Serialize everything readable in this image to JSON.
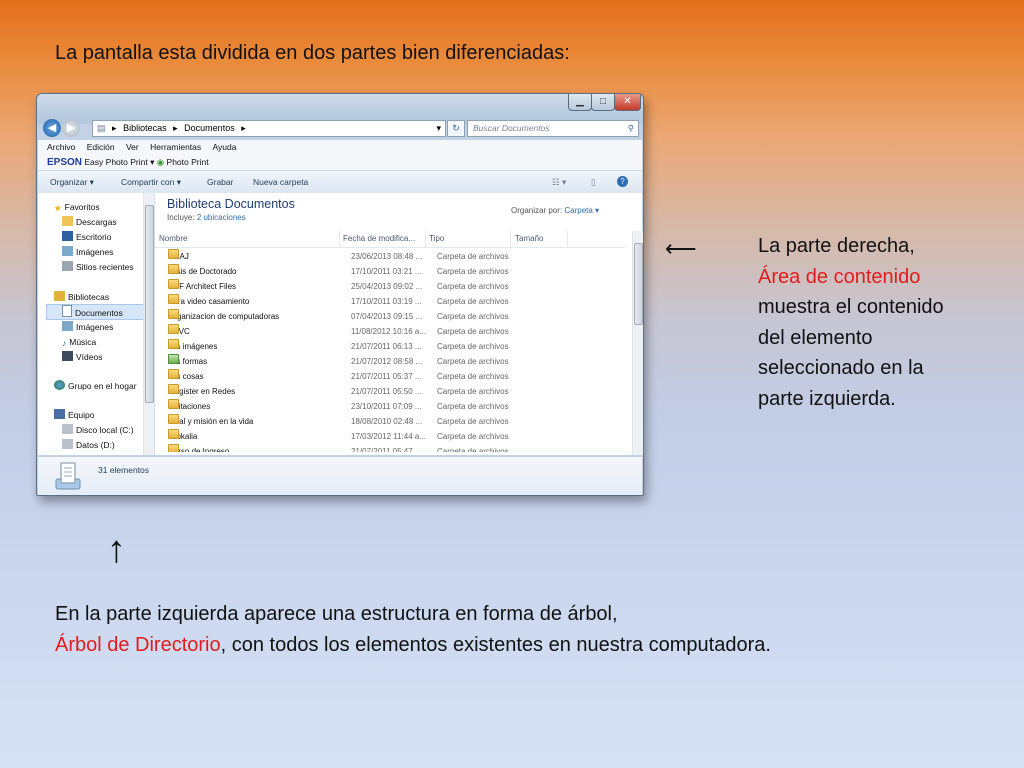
{
  "slide": {
    "intro": "La pantalla esta dividida en dos partes bien diferenciadas:",
    "right_note_pre": "La parte derecha,",
    "right_note_red": "Área de contenido",
    "right_note_post": "muestra el contenido del elemento seleccionado en la parte izquierda.",
    "bottom_note_pre": "En la parte izquierda aparece una estructura en forma de árbol,",
    "bottom_note_red": "Árbol de Directorio",
    "bottom_note_post": ", con todos los elementos existentes en nuestra computadora.",
    "arrow_left": "⟵",
    "arrow_up": "↑",
    "accent_red": "#e31c1c"
  },
  "window": {
    "address": {
      "sep1": "▸",
      "seg1": "Bibliotecas",
      "sep2": "▸",
      "seg2": "Documentos",
      "sep3": "▸"
    },
    "search_placeholder": "Buscar Documentos",
    "menu": [
      "Archivo",
      "Edición",
      "Ver",
      "Herramientas",
      "Ayuda"
    ],
    "epson": {
      "logo": "EPSON",
      "app1": "Easy Photo Print",
      "app2": "Photo Print"
    },
    "commands": {
      "organize": "Organizar ▾",
      "share": "Compartir con ▾",
      "burn": "Grabar",
      "new_folder": "Nueva carpeta"
    },
    "nav": {
      "favorites": "Favoritos",
      "downloads": "Descargas",
      "desktop": "Escritorio",
      "images": "Imágenes",
      "recent": "Sitios recientes",
      "libraries": "Bibliotecas",
      "documents": "Documentos",
      "lib_images": "Imágenes",
      "music": "Música",
      "videos": "Vídeos",
      "homegroup": "Grupo en el hogar",
      "computer": "Equipo",
      "local_disk": "Disco local (C:)",
      "data_disk": "Datos (D:)"
    },
    "library": {
      "title": "Biblioteca Documentos",
      "includes_label": "Incluye:",
      "includes_link": "2 ubicaciones",
      "arrange_label": "Organizar por:",
      "arrange_value": "Carpeta ▾"
    },
    "columns": {
      "name": "Nombre",
      "date": "Fecha de modifica...",
      "type": "Tipo",
      "size": "Tamaño"
    },
    "files": [
      {
        "name": "UNAJ",
        "date": "23/06/2013 08:48 ...",
        "type": "Carpeta de archivos"
      },
      {
        "name": "Tesis de Doctorado",
        "date": "17/10/2011 03:21 ...",
        "type": "Carpeta de archivos"
      },
      {
        "name": "PDF Architect Files",
        "date": "25/04/2013 09:02 ...",
        "type": "Carpeta de archivos"
      },
      {
        "name": "Para video casamiento",
        "date": "17/10/2011 03:19 ...",
        "type": "Carpeta de archivos"
      },
      {
        "name": "Organizacion de computadoras",
        "date": "07/04/2013 09:15 ...",
        "type": "Carpeta de archivos"
      },
      {
        "name": "MJVC",
        "date": "11/08/2012 10:16 a...",
        "type": "Carpeta de archivos"
      },
      {
        "name": "Mis imágenes",
        "date": "21/07/2011 06:13 ...",
        "type": "Carpeta de archivos"
      },
      {
        "name": "Mis formas",
        "date": "21/07/2012 08:58 ...",
        "type": "Carpeta de archivos"
      },
      {
        "name": "Mis cosas",
        "date": "21/07/2011 05:37 ...",
        "type": "Carpeta de archivos"
      },
      {
        "name": "Magister en Redes",
        "date": "21/07/2011 05:50 ...",
        "type": "Carpeta de archivos"
      },
      {
        "name": "Invitaciones",
        "date": "23/10/2011 07:09 ...",
        "type": "Carpeta de archivos"
      },
      {
        "name": "Ideal y misión en la vida",
        "date": "18/08/2010 02:48 ...",
        "type": "Carpeta de archivos"
      },
      {
        "name": "Filokalia",
        "date": "17/03/2012 11:44 a...",
        "type": "Carpeta de archivos"
      },
      {
        "name": "Curso de Ingreso",
        "date": "21/07/2011 05:47 ...",
        "type": "Carpeta de archivos"
      }
    ],
    "status": "31 elementos"
  }
}
